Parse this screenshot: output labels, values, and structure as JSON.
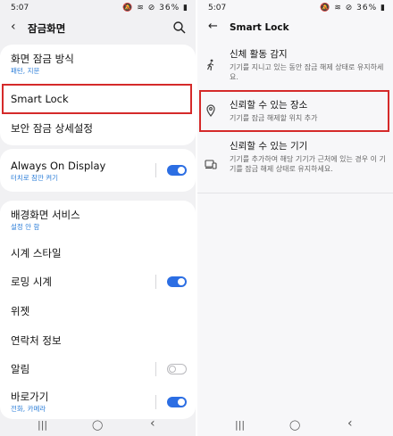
{
  "left": {
    "status": {
      "time": "5:07",
      "battery": "36%"
    },
    "header": {
      "title": "잠금화면"
    },
    "card1": [
      {
        "title": "화면 잠금 방식",
        "subtitle": "패턴, 지문"
      },
      {
        "title": "Smart Lock"
      },
      {
        "title": "보안 잠금 상세설정"
      }
    ],
    "card2": [
      {
        "title": "Always On Display",
        "subtitle": "터치로 잠깐 켜기",
        "toggle": true
      }
    ],
    "card3": [
      {
        "title": "배경화면 서비스",
        "subtitle": "설정 안 함"
      },
      {
        "title": "시계 스타일"
      },
      {
        "title": "로밍 시계",
        "toggle": true
      },
      {
        "title": "위젯"
      },
      {
        "title": "연락처 정보"
      },
      {
        "title": "알림",
        "toggle": false
      },
      {
        "title": "바로가기",
        "subtitle": "전화, 카메라",
        "toggle": true
      }
    ]
  },
  "right": {
    "status": {
      "time": "5:07",
      "battery": "36%"
    },
    "header": {
      "title": "Smart Lock"
    },
    "items": [
      {
        "title": "신체 활동 감지",
        "desc": "기기를 지니고 있는 동안 잠금 해제 상태로 유지하세요.",
        "icon": "walking-person-icon"
      },
      {
        "title": "신뢰할 수 있는 장소",
        "desc": "기기를 잠금 해제할 위치 추가",
        "icon": "location-pin-icon"
      },
      {
        "title": "신뢰할 수 있는 기기",
        "desc": "기기를 추가하여 해당 기기가 근처에 있는 경우 이 기기를 잠금 해제 상태로 유지하세요.",
        "icon": "devices-icon"
      }
    ]
  },
  "nav": {
    "recents": "|||",
    "home": "◯",
    "back": "‹"
  },
  "colors": {
    "accent": "#2c6ee3",
    "highlight": "#d52a2a",
    "subtitle": "#2e7fd9"
  }
}
